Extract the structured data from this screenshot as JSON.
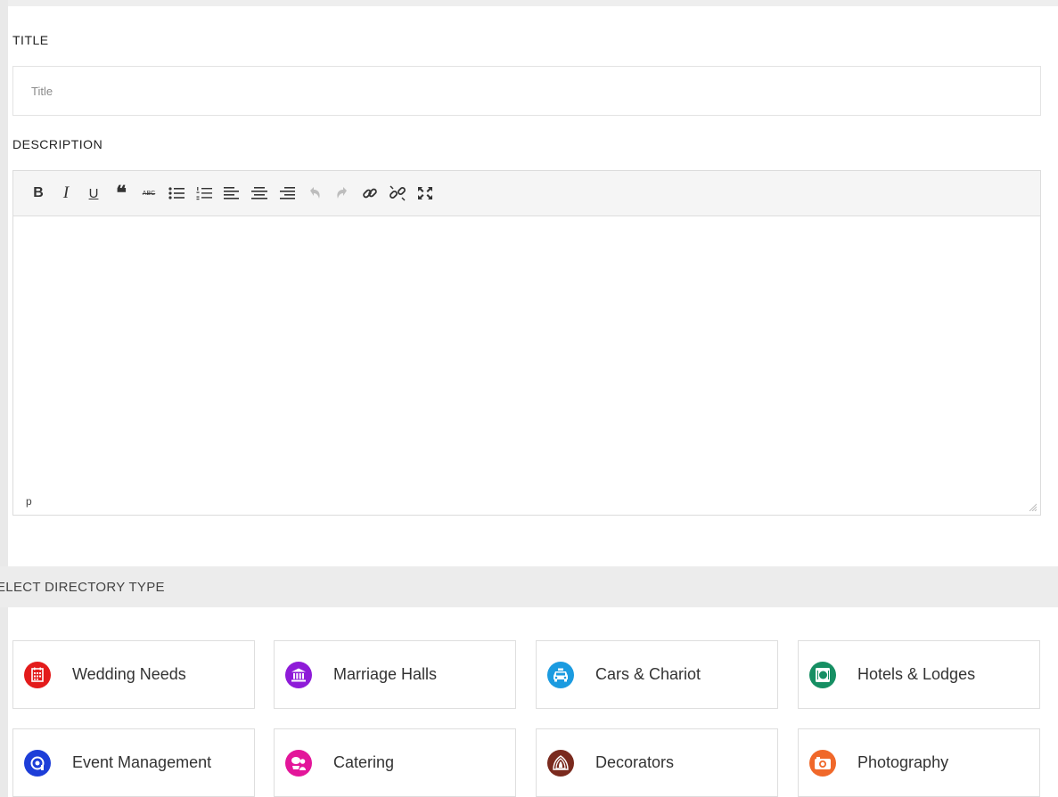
{
  "form": {
    "title_label": "TITLE",
    "title_placeholder": "Title",
    "title_value": "",
    "description_label": "DESCRIPTION"
  },
  "editor": {
    "toolbar": [
      {
        "name": "bold-button",
        "label": "B"
      },
      {
        "name": "italic-button",
        "label": "I"
      },
      {
        "name": "underline-button",
        "label": "U"
      },
      {
        "name": "blockquote-button",
        "label": "❝"
      },
      {
        "name": "strikethrough-button",
        "label": "ABC"
      },
      {
        "name": "bullet-list-button",
        "icon": "bullet-list-icon"
      },
      {
        "name": "numbered-list-button",
        "icon": "numbered-list-icon"
      },
      {
        "name": "align-left-button",
        "icon": "align-left-icon"
      },
      {
        "name": "align-center-button",
        "icon": "align-center-icon"
      },
      {
        "name": "align-right-button",
        "icon": "align-right-icon"
      },
      {
        "name": "undo-button",
        "icon": "undo-icon"
      },
      {
        "name": "redo-button",
        "icon": "redo-icon"
      },
      {
        "name": "link-button",
        "icon": "link-icon"
      },
      {
        "name": "unlink-button",
        "icon": "unlink-icon"
      },
      {
        "name": "fullscreen-button",
        "icon": "fullscreen-icon"
      }
    ],
    "status_path": "p"
  },
  "directory": {
    "section_title": "ELECT DIRECTORY TYPE",
    "types": [
      {
        "label": "Wedding Needs",
        "icon": "calendar-icon",
        "color": "#e31b1b"
      },
      {
        "label": "Marriage Halls",
        "icon": "hall-icon",
        "color": "#8e1bd8"
      },
      {
        "label": "Cars & Chariot",
        "icon": "car-icon",
        "color": "#1b9be0"
      },
      {
        "label": "Hotels & Lodges",
        "icon": "hotel-icon",
        "color": "#168f63"
      },
      {
        "label": "Event Management",
        "icon": "event-icon",
        "color": "#1d3ed8"
      },
      {
        "label": "Catering",
        "icon": "catering-icon",
        "color": "#e3169a"
      },
      {
        "label": "Decorators",
        "icon": "decor-icon",
        "color": "#7a2a1e"
      },
      {
        "label": "Photography",
        "icon": "camera-icon",
        "color": "#f0682a"
      }
    ]
  }
}
